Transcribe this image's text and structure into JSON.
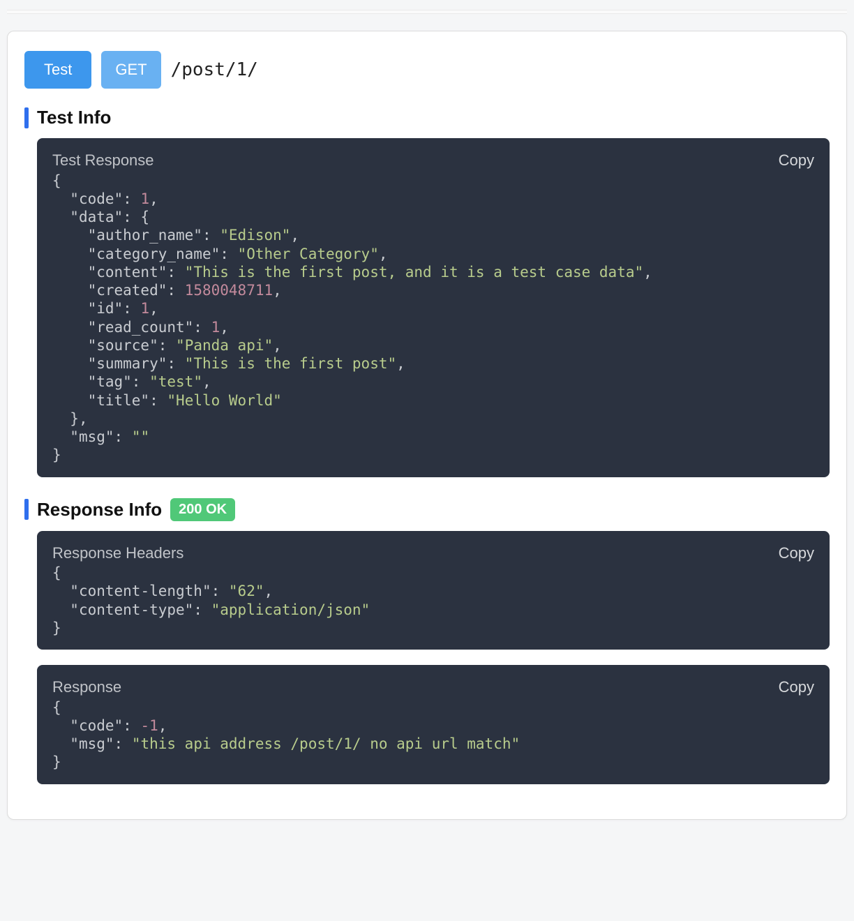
{
  "header": {
    "test_button": "Test",
    "method_button": "GET",
    "path": "/post/1/"
  },
  "sections": {
    "test_info_title": "Test Info",
    "response_info_title": "Response Info",
    "status_badge": "200 OK"
  },
  "blocks": {
    "test_response_label": "Test Response",
    "headers_label": "Response Headers",
    "response_label": "Response",
    "copy_label": "Copy"
  },
  "test_response_data": {
    "code": 1,
    "data": {
      "author_name": "Edison",
      "category_name": "Other Category",
      "content": "This is the first post, and it is a test case data",
      "created": 1580048711,
      "id": 1,
      "read_count": 1,
      "source": "Panda api",
      "summary": "This is the first post",
      "tag": "test",
      "title": "Hello World"
    },
    "msg": ""
  },
  "response_headers_data": {
    "content-length": "62",
    "content-type": "application/json"
  },
  "response_data": {
    "code": -1,
    "msg": "this api address /post/1/ no api url match"
  }
}
